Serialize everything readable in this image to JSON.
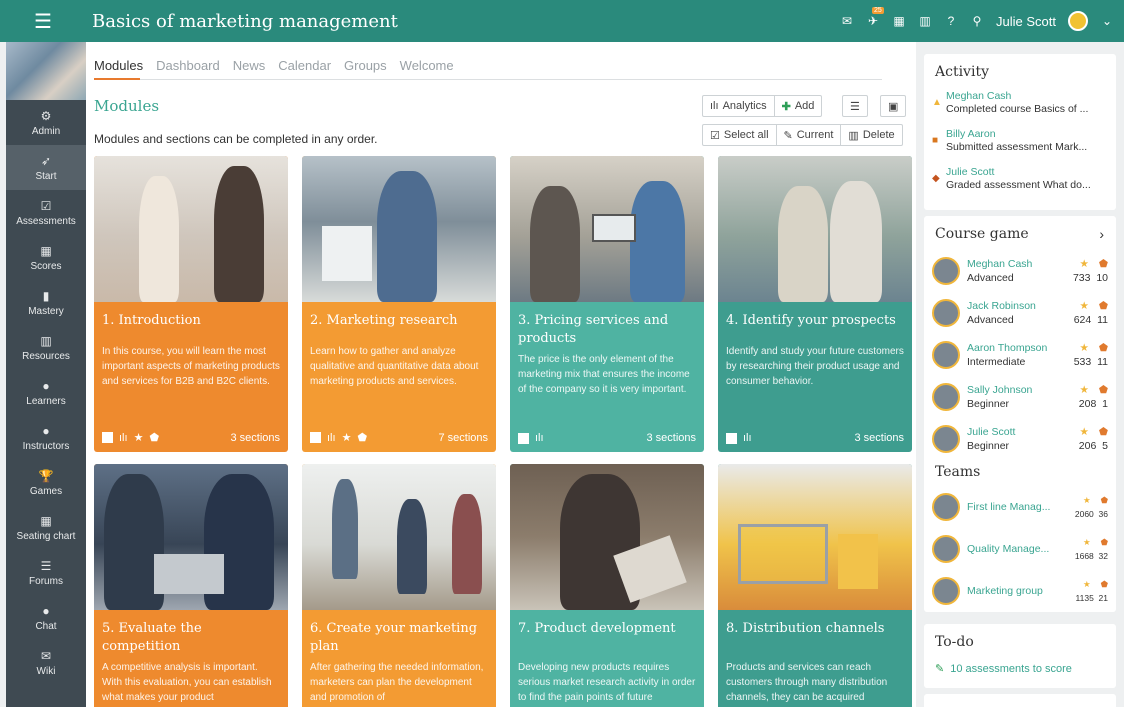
{
  "header": {
    "title": "Basics of marketing management",
    "notif_count": "25",
    "user_name": "Julie Scott"
  },
  "sidebar": {
    "items": [
      {
        "label": "Admin",
        "icon": "gear-icon",
        "glyph": "⚙"
      },
      {
        "label": "Start",
        "icon": "rocket-icon",
        "glyph": "➶"
      },
      {
        "label": "Assessments",
        "icon": "checkbox-icon",
        "glyph": "☑"
      },
      {
        "label": "Scores",
        "icon": "grid-icon",
        "glyph": "▦"
      },
      {
        "label": "Mastery",
        "icon": "bar-chart-icon",
        "glyph": "▮"
      },
      {
        "label": "Resources",
        "icon": "library-icon",
        "glyph": "▥"
      },
      {
        "label": "Learners",
        "icon": "person-icon",
        "glyph": "●"
      },
      {
        "label": "Instructors",
        "icon": "instructor-icon",
        "glyph": "●"
      },
      {
        "label": "Games",
        "icon": "trophy-icon",
        "glyph": "🏆"
      },
      {
        "label": "Seating chart",
        "icon": "seating-icon",
        "glyph": "▦"
      },
      {
        "label": "Forums",
        "icon": "forums-icon",
        "glyph": "☰"
      },
      {
        "label": "Chat",
        "icon": "chat-icon",
        "glyph": "●"
      },
      {
        "label": "Wiki",
        "icon": "wiki-icon",
        "glyph": "✉"
      }
    ]
  },
  "tabs": [
    "Modules",
    "Dashboard",
    "News",
    "Calendar",
    "Groups",
    "Welcome"
  ],
  "modules": {
    "title": "Modules",
    "note": "Modules and sections can be completed in any order.",
    "toolbar": {
      "analytics": "Analytics",
      "add": "Add",
      "select_all": "Select all",
      "current": "Current",
      "delete": "Delete"
    },
    "cards": [
      {
        "title": "1. Introduction",
        "desc": "In this course, you will learn the most important aspects of marketing products and services for B2B and B2C clients.",
        "sections": "3 sections"
      },
      {
        "title": "2. Marketing research",
        "desc": "Learn how to gather and analyze qualitative and quantitative data about marketing products and services.",
        "sections": "7 sections"
      },
      {
        "title": "3. Pricing services and products",
        "desc": "The price is the only element of the marketing mix that ensures the income of the company so it is very important.",
        "sections": "3 sections"
      },
      {
        "title": "4. Identify your prospects",
        "desc": "Identify and study your future customers by researching their product usage and consumer behavior.",
        "sections": "3 sections"
      },
      {
        "title": "5. Evaluate the competition",
        "desc": "A competitive analysis is important. With this evaluation, you can establish what makes your product"
      },
      {
        "title": "6. Create your marketing plan",
        "desc": "After gathering the needed information, marketers can plan the development and promotion of"
      },
      {
        "title": "7. Product development",
        "desc": "Developing new products requires serious market research activity in order to find the pain points of future"
      },
      {
        "title": "8. Distribution channels",
        "desc": "Products and services can reach customers through many distribution channels, they can be acquired"
      }
    ]
  },
  "activity": {
    "title": "Activity",
    "items": [
      {
        "name": "Meghan Cash",
        "text": "Completed course Basics of ..."
      },
      {
        "name": "Billy Aaron",
        "text": "Submitted assessment Mark..."
      },
      {
        "name": "Julie Scott",
        "text": "Graded assessment What do..."
      }
    ]
  },
  "course_game": {
    "title": "Course game",
    "players": [
      {
        "name": "Meghan Cash",
        "level": "Advanced",
        "points": "733",
        "badges": "10"
      },
      {
        "name": "Jack Robinson",
        "level": "Advanced",
        "points": "624",
        "badges": "11"
      },
      {
        "name": "Aaron Thompson",
        "level": "Intermediate",
        "points": "533",
        "badges": "11"
      },
      {
        "name": "Sally Johnson",
        "level": "Beginner",
        "points": "208",
        "badges": "1"
      },
      {
        "name": "Julie Scott",
        "level": "Beginner",
        "points": "206",
        "badges": "5"
      }
    ],
    "teams_title": "Teams",
    "teams": [
      {
        "name": "First line Manag...",
        "points": "2060",
        "badges": "36"
      },
      {
        "name": "Quality Manage...",
        "points": "1668",
        "badges": "32"
      },
      {
        "name": "Marketing group",
        "points": "1135",
        "badges": "21"
      }
    ]
  },
  "todo": {
    "title": "To-do",
    "item": "10 assessments to score"
  }
}
